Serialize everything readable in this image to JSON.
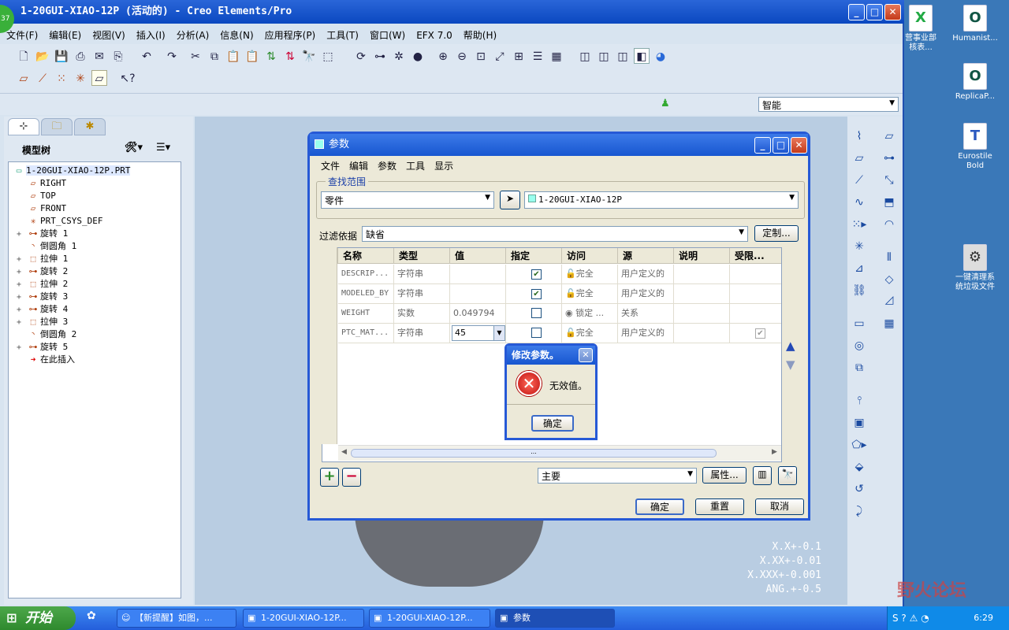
{
  "app": {
    "title": "1-20GUI-XIAO-12P (活动的) - Creo Elements/Pro",
    "badge": "37",
    "menus": [
      "文件(F)",
      "编辑(E)",
      "视图(V)",
      "插入(I)",
      "分析(A)",
      "信息(N)",
      "应用程序(P)",
      "工具(T)",
      "窗口(W)",
      "EFX 7.0",
      "帮助(H)"
    ],
    "selection_filter": "智能"
  },
  "model_tree": {
    "header": "模型树",
    "items": [
      {
        "label": "1-20GUI-XIAO-12P.PRT",
        "icon": "part-icon",
        "expandable": false,
        "level": 0
      },
      {
        "label": "RIGHT",
        "icon": "datum-plane-icon",
        "expandable": false,
        "level": 1
      },
      {
        "label": "TOP",
        "icon": "datum-plane-icon",
        "expandable": false,
        "level": 1
      },
      {
        "label": "FRONT",
        "icon": "datum-plane-icon",
        "expandable": false,
        "level": 1
      },
      {
        "label": "PRT_CSYS_DEF",
        "icon": "csys-icon",
        "expandable": false,
        "level": 1
      },
      {
        "label": "旋转 1",
        "icon": "revolve-icon",
        "expandable": true,
        "level": 1
      },
      {
        "label": "倒圆角 1",
        "icon": "round-icon",
        "expandable": false,
        "level": 1
      },
      {
        "label": "拉伸 1",
        "icon": "extrude-icon",
        "expandable": true,
        "level": 1
      },
      {
        "label": "旋转 2",
        "icon": "revolve-icon",
        "expandable": true,
        "level": 1
      },
      {
        "label": "拉伸 2",
        "icon": "extrude-icon",
        "expandable": true,
        "level": 1
      },
      {
        "label": "旋转 3",
        "icon": "revolve-icon",
        "expandable": true,
        "level": 1
      },
      {
        "label": "旋转 4",
        "icon": "revolve-icon",
        "expandable": true,
        "level": 1
      },
      {
        "label": "拉伸 3",
        "icon": "extrude-icon",
        "expandable": true,
        "level": 1
      },
      {
        "label": "倒圆角 2",
        "icon": "round-icon",
        "expandable": false,
        "level": 1
      },
      {
        "label": "旋转 5",
        "icon": "revolve-icon",
        "expandable": true,
        "level": 1
      },
      {
        "label": "在此插入",
        "icon": "insert-here-icon",
        "expandable": false,
        "level": 1
      }
    ]
  },
  "params_dialog": {
    "title": "参数",
    "menus": [
      "文件",
      "编辑",
      "参数",
      "工具",
      "显示"
    ],
    "scope_label": "查找范围",
    "scope_type": "零件",
    "scope_target": "1-20GUI-XIAO-12P",
    "filter_label": "过滤依据",
    "filter_value": "缺省",
    "customize": "定制...",
    "columns": [
      "名称",
      "类型",
      "值",
      "指定",
      "访问",
      "源",
      "说明",
      "受限..."
    ],
    "rows": [
      {
        "name": "DESCRIP...",
        "type": "字符串",
        "value": "",
        "designate": true,
        "access": "完全",
        "source": "用户定义的",
        "desc": "",
        "restricted": false
      },
      {
        "name": "MODELED_BY",
        "type": "字符串",
        "value": "",
        "designate": true,
        "access": "完全",
        "source": "用户定义的",
        "desc": "",
        "restricted": false
      },
      {
        "name": "WEIGHT",
        "type": "实数",
        "value": "0.049794",
        "designate": false,
        "access": "锁定 ...",
        "source": "关系",
        "desc": "",
        "restricted": false
      },
      {
        "name": "PTC_MAT...",
        "type": "字符串",
        "value": "45",
        "designate": false,
        "access": "完全",
        "source": "用户定义的",
        "desc": "",
        "restricted": true
      }
    ],
    "scroll_grip": "...",
    "view_select": "主要",
    "properties": "属性...",
    "ok": "确定",
    "reset": "重置",
    "cancel": "取消"
  },
  "error_dialog": {
    "title": "修改参数。",
    "message": "无效值。",
    "ok": "确定"
  },
  "tolerance": [
    "X.X+-0.1",
    "X.XX+-0.01",
    "X.XXX+-0.001",
    "ANG.+-0.5"
  ],
  "desktop_icons": [
    {
      "label": "营事业部\n核表...",
      "icon": "excel-icon"
    },
    {
      "label": "Humanist...",
      "icon": "font-o-icon"
    },
    {
      "label": "ReplicaP...",
      "icon": "font-o-icon"
    },
    {
      "label": "Eurostile\nBold",
      "icon": "font-t-icon"
    },
    {
      "label": "一键清理系\n统垃圾文件",
      "icon": "cleanup-icon"
    }
  ],
  "taskbar": {
    "start": "开始",
    "tasks": [
      "【新提醒】如图，...",
      "1-20GUI-XIAO-12P...",
      "1-20GUI-XIAO-12P...",
      "参数"
    ],
    "clock": "6:29"
  },
  "watermark": "野火论坛"
}
